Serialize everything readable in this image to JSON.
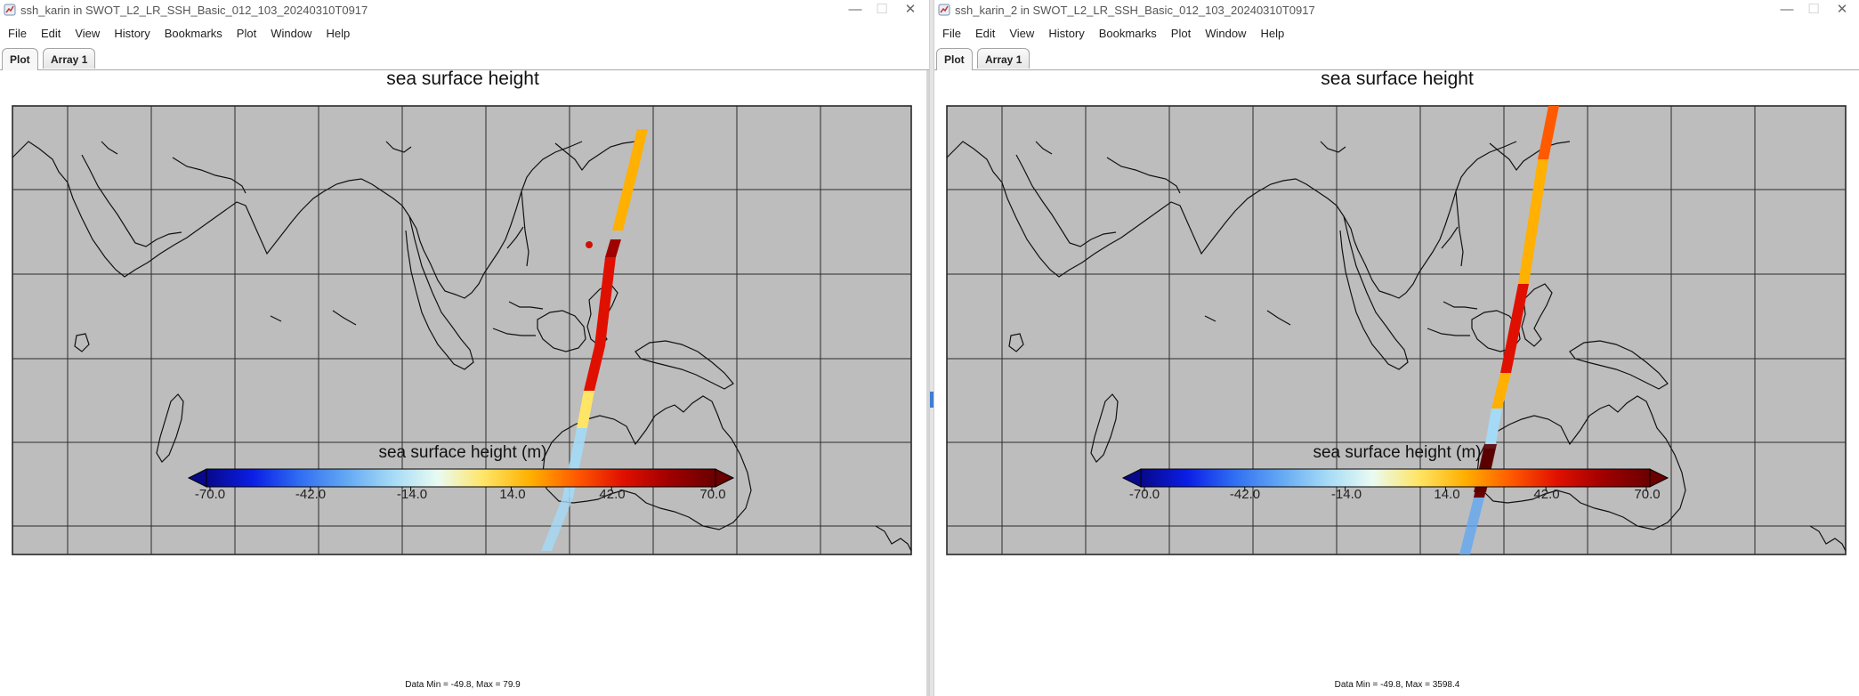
{
  "windows": [
    {
      "id": "win1",
      "title": "ssh_karin in SWOT_L2_LR_SSH_Basic_012_103_20240310T0917",
      "menus": [
        "File",
        "Edit",
        "View",
        "History",
        "Bookmarks",
        "Plot",
        "Window",
        "Help"
      ],
      "tabs": [
        {
          "label": "Plot",
          "active": true
        },
        {
          "label": "Array 1",
          "active": false
        }
      ],
      "plot_title": "sea surface height",
      "colorbar": {
        "title": "sea surface height (m)",
        "ticks": [
          "-70.0",
          "-42.0",
          "-14.0",
          "14.0",
          "42.0",
          "70.0"
        ]
      },
      "stats": "Data Min = -49.8, Max = 79.9"
    },
    {
      "id": "win2",
      "title": "ssh_karin_2 in SWOT_L2_LR_SSH_Basic_012_103_20240310T0917",
      "menus": [
        "File",
        "Edit",
        "View",
        "History",
        "Bookmarks",
        "Plot",
        "Window",
        "Help"
      ],
      "tabs": [
        {
          "label": "Plot",
          "active": true
        },
        {
          "label": "Array 1",
          "active": false
        }
      ],
      "plot_title": "sea surface height",
      "colorbar": {
        "title": "sea surface height (m)",
        "ticks": [
          "-70.0",
          "-42.0",
          "-14.0",
          "14.0",
          "42.0",
          "70.0"
        ]
      },
      "stats": "Data Min = -49.8, Max = 3598.4"
    }
  ],
  "icons": {
    "app": "java-app-icon",
    "minimize": "minimize-icon",
    "maximize": "maximize-icon",
    "close": "close-icon"
  },
  "colors": {
    "map_bg": "#bdbdbd",
    "grid": "#2b2b2b",
    "coast": "#111111",
    "colorbar_low": "#0a0ac8",
    "colorbar_high": "#7a0000"
  },
  "colormap": [
    "#08088a",
    "#0b1ee6",
    "#2f6df2",
    "#62a7f3",
    "#a4daf6",
    "#e9fbf2",
    "#ffe566",
    "#ffb000",
    "#ff5a00",
    "#e01000",
    "#a00000",
    "#6a0000"
  ]
}
